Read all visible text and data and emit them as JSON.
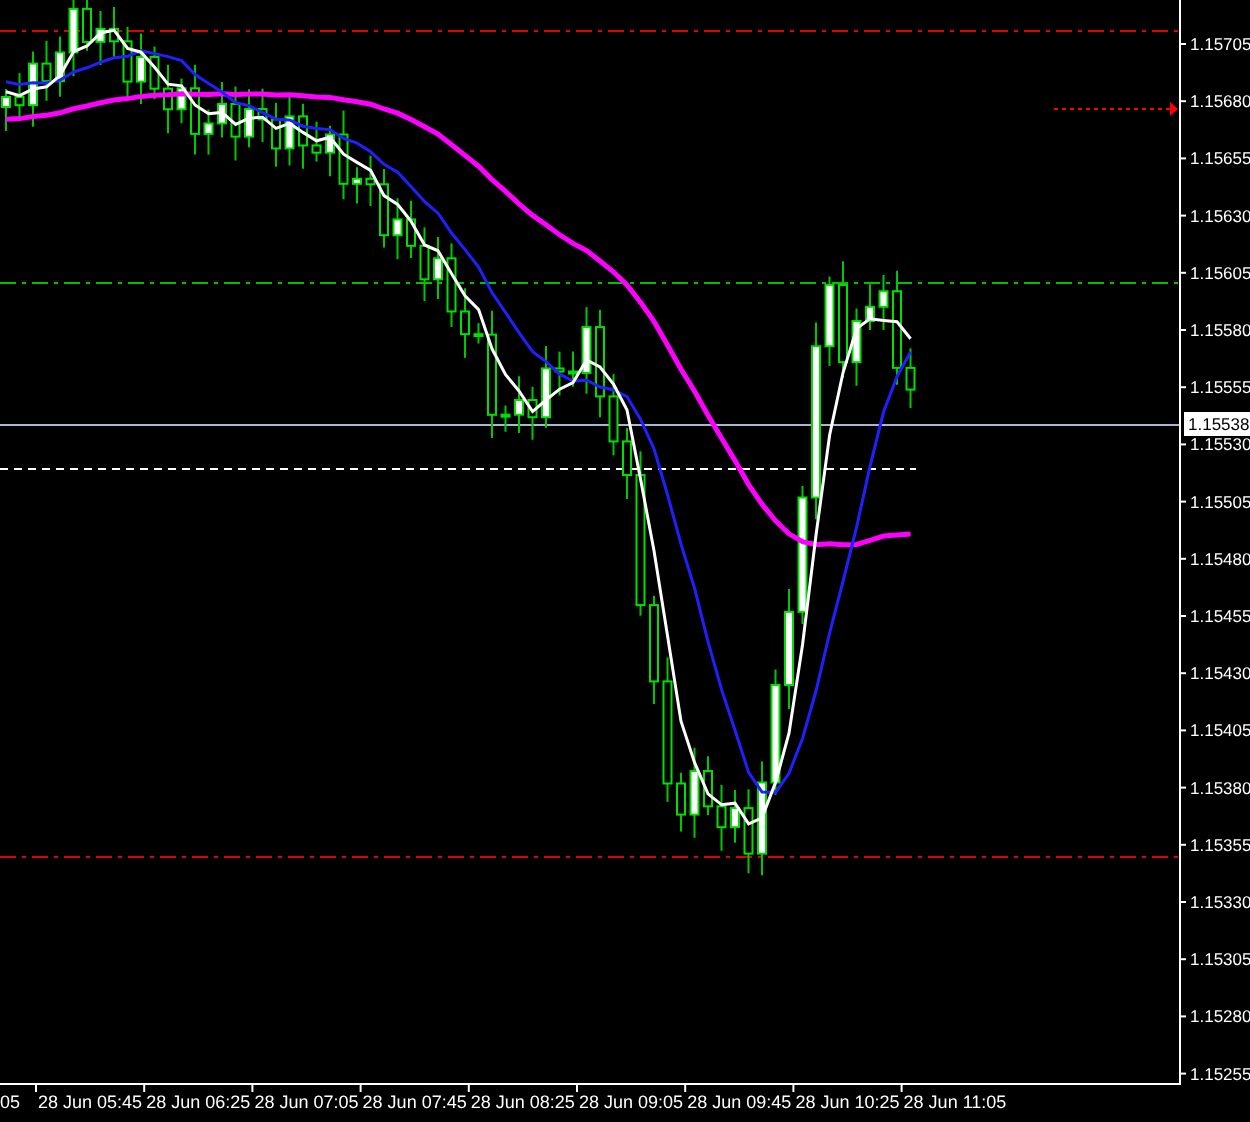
{
  "price_axis": {
    "labels": [
      "1.15705",
      "1.15680",
      "1.15655",
      "1.15630",
      "1.15605",
      "1.15580",
      "1.15555",
      "1.15530",
      "1.15505",
      "1.15480",
      "1.15455",
      "1.15430",
      "1.15405",
      "1.15380",
      "1.15355",
      "1.15330",
      "1.15305",
      "1.15280",
      "1.15255"
    ],
    "current_price": "1.15538"
  },
  "time_axis": {
    "labels": [
      "05",
      "28 Jun 05:45",
      "28 Jun 06:25",
      "28 Jun 07:05",
      "28 Jun 07:45",
      "28 Jun 08:25",
      "28 Jun 09:05",
      "28 Jun 09:45",
      "28 Jun 10:25",
      "28 Jun 11:05"
    ]
  }
}
